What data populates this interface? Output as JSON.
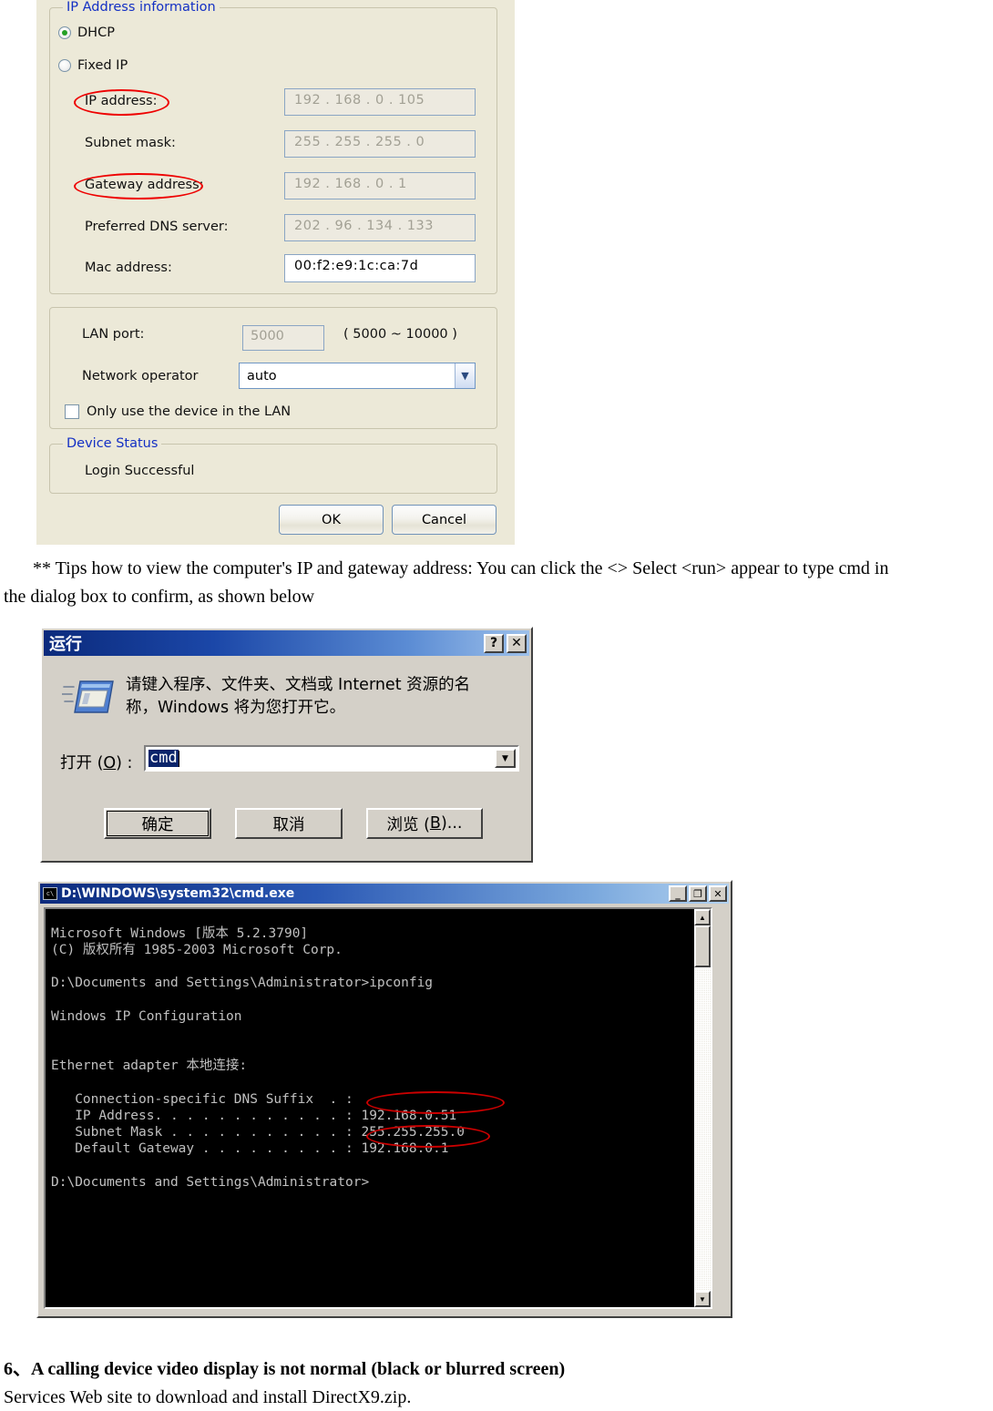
{
  "ip_dialog": {
    "group_ip_title": "IP Address information",
    "radio_dhcp": "DHCP",
    "radio_fixed": "Fixed IP",
    "label_ip": "IP address:",
    "label_subnet": "Subnet mask:",
    "label_gateway": "Gateway address:",
    "label_dns": "Preferred DNS server:",
    "label_mac": "Mac address:",
    "value_ip": "192 . 168 .  0   . 105",
    "value_subnet": "255 . 255 . 255 .  0",
    "value_gateway": "192 . 168 .  0   .  1",
    "value_dns": "202 .  96  . 134 . 133",
    "value_mac": "00:f2:e9:1c:ca:7d",
    "label_lan_port": "LAN port:",
    "value_lan_port": "5000",
    "lan_port_range": "( 5000 ~ 10000 )",
    "label_network_operator": "Network operator",
    "value_network_operator": "auto",
    "checkbox_lan_only": "Only use the device in the LAN",
    "group_status_title": "Device Status",
    "status_text": "Login Successful",
    "button_ok": "OK",
    "button_cancel": "Cancel",
    "accent_legend_color": "#1430c4",
    "annotation_color": "#ee0000",
    "dialog_background": "#ece9d8"
  },
  "tips_paragraph": {
    "line1": "** Tips how to view the computer's IP and gateway address: You can click the <> Select <run> appear to type cmd in",
    "line2": "the dialog box to confirm, as shown below"
  },
  "run_dialog": {
    "title": "运行",
    "help_button": "?",
    "close_button": "✕",
    "prompt_line1": "请键入程序、文件夹、文档或 Internet 资源的名",
    "prompt_line2": "称，Windows 将为您打开它。",
    "open_label_pre": "打开 (",
    "open_label_key": "O",
    "open_label_post": ") :",
    "open_value": "cmd",
    "button_ok": "确定",
    "button_cancel": "取消",
    "button_browse_pre": "浏览 (",
    "button_browse_key": "B",
    "button_browse_post": ")...",
    "titlebar_color": "#0b2a7c"
  },
  "cmd_window": {
    "title": "D:\\WINDOWS\\system32\\cmd.exe",
    "minimize": "_",
    "maximize": "❐",
    "close": "✕",
    "console_text": "Microsoft Windows [版本 5.2.3790]\n(C) 版权所有 1985-2003 Microsoft Corp.\n\nD:\\Documents and Settings\\Administrator>ipconfig\n\nWindows IP Configuration\n\n\nEthernet adapter 本地连接:\n\n   Connection-specific DNS Suffix  . :\n   IP Address. . . . . . . . . . . . : 192.168.0.51\n   Subnet Mask . . . . . . . . . . . : 255.255.255.0\n   Default Gateway . . . . . . . . . : 192.168.0.1\n\nD:\\Documents and Settings\\Administrator>",
    "annotated_ip_address": "192.168.0.51",
    "annotated_default_gateway": "192.168.0.1",
    "scroll_up_arrow": "▲",
    "scroll_down_arrow": "▼",
    "console_background": "#000000",
    "console_foreground": "#c0c0c0"
  },
  "footer": {
    "heading": "6、A calling device video display is not normal (black or blurred screen)",
    "body": "Services Web site to download and install DirectX9.zip."
  }
}
